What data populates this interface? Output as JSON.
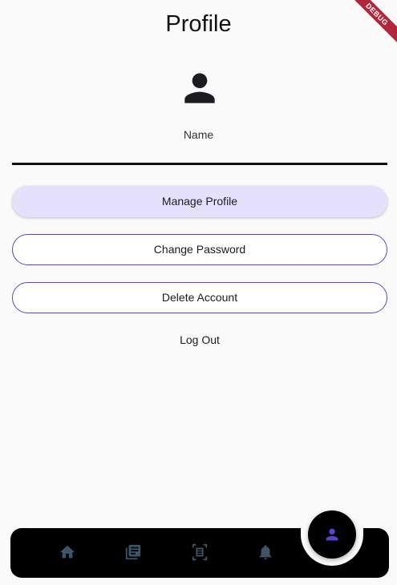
{
  "header": {
    "title": "Profile"
  },
  "debug_banner": {
    "label": "DEBUG"
  },
  "profile": {
    "name_label": "Name",
    "name_value": ""
  },
  "actions": {
    "manage_profile": "Manage Profile",
    "change_password": "Change Password",
    "delete_account": "Delete Account",
    "log_out": "Log Out"
  },
  "bottom_nav": {
    "items": [
      {
        "icon": "home-icon"
      },
      {
        "icon": "newspaper-icon"
      },
      {
        "icon": "document-scanner-icon"
      },
      {
        "icon": "bell-icon"
      },
      {
        "icon": "person-icon",
        "active": true
      }
    ]
  },
  "colors": {
    "background": "#fafafa",
    "primary_tint": "#e5e0fb",
    "outline": "#5b4bb5",
    "nav_icon": "#3d5466",
    "active_icon": "#5b3fd6"
  }
}
